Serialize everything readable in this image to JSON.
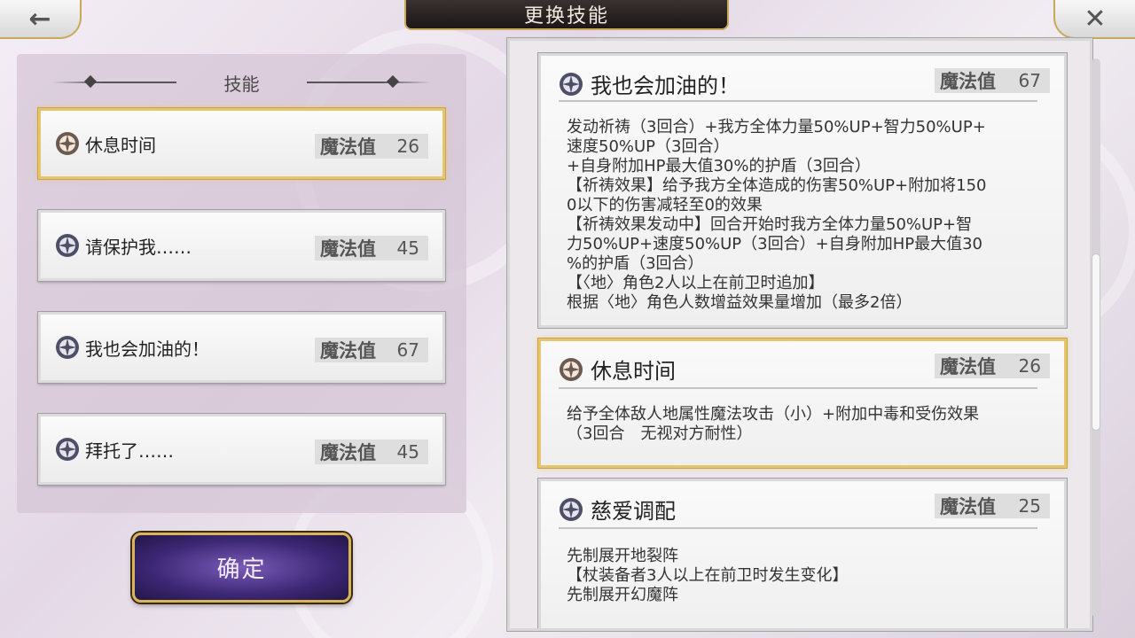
{
  "header": {
    "title": "更换技能",
    "back_icon": "←",
    "close_icon": "✕"
  },
  "left_panel": {
    "header": "技能",
    "skills": [
      {
        "name": "休息时间",
        "mp_label": "魔法值",
        "mp": "26",
        "selected": true
      },
      {
        "name": "请保护我……",
        "mp_label": "魔法值",
        "mp": "45",
        "selected": false
      },
      {
        "name": "我也会加油的！",
        "mp_label": "魔法值",
        "mp": "67",
        "selected": false
      },
      {
        "name": "拜托了……",
        "mp_label": "魔法值",
        "mp": "45",
        "selected": false
      }
    ],
    "confirm_label": "确定"
  },
  "right_panel": {
    "cards": [
      {
        "title": "我也会加油的！",
        "mp_label": "魔法值",
        "mp": "67",
        "desc": "发动祈祷（3回合）+我方全体力量50%UP+智力50%UP+\n速度50%UP（3回合）\n+自身附加HP最大值30%的护盾（3回合）\n【祈祷效果】给予我方全体造成的伤害50%UP+附加将150\n0以下的伤害减轻至0的效果\n【祈祷效果发动中】回合开始时我方全体力量50%UP+智\n力50%UP+速度50%UP（3回合）+自身附加HP最大值30\n%的护盾（3回合）\n【〈地〉角色2人以上在前卫时追加】\n根据〈地〉角色人数增益效果量增加（最多2倍）"
      },
      {
        "title": "休息时间",
        "mp_label": "魔法值",
        "mp": "26",
        "desc": "给予全体敌人地属性魔法攻击（小）+附加中毒和受伤效果\n（3回合　无视对方耐性）"
      },
      {
        "title": "慈爱调配",
        "mp_label": "魔法值",
        "mp": "25",
        "desc": "先制展开地裂阵\n【杖装备者3人以上在前卫时发生变化】\n先制展开幻魔阵"
      }
    ]
  },
  "colors": {
    "gold": "#c9a95a",
    "title_bg": "#1d1717",
    "confirm": "#3c2774"
  }
}
